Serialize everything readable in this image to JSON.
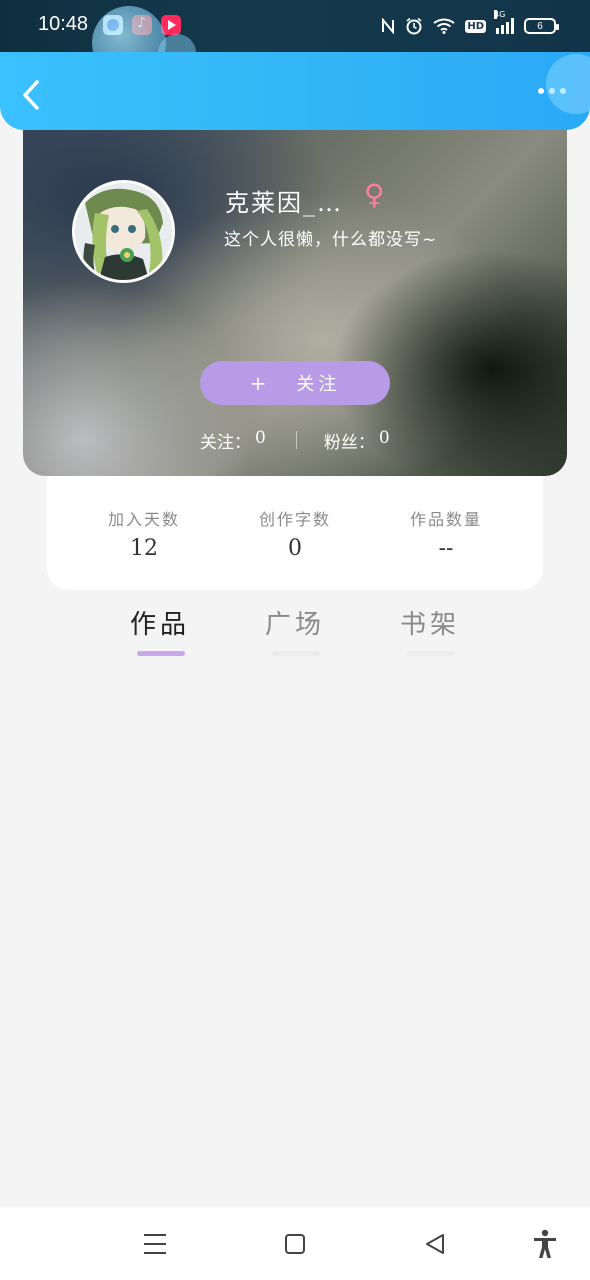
{
  "status_bar": {
    "time": "10:48",
    "network": "4G",
    "hd": "HD",
    "battery": "6"
  },
  "header": {
    "back_icon": "chevron-left-icon",
    "more_icon": "more-dots-icon"
  },
  "profile": {
    "username": "克莱因_…",
    "gender_symbol": "♀",
    "bio": "这个人很懒，什么都没写~",
    "follow_plus": "+",
    "follow_label": "关注",
    "following_label": "关注：",
    "following_value": "0",
    "fans_label": "粉丝：",
    "fans_value": "0"
  },
  "stats": [
    {
      "label": "加入天数",
      "value": "12"
    },
    {
      "label": "创作字数",
      "value": "0"
    },
    {
      "label": "作品数量",
      "value": "--"
    }
  ],
  "tabs": [
    {
      "label": "作品",
      "active": true
    },
    {
      "label": "广场",
      "active": false
    },
    {
      "label": "书架",
      "active": false
    }
  ],
  "colors": {
    "header_blue": "#33b6f5",
    "follow_button": "#b79be6",
    "active_tab_underline": "#c8a8e8",
    "gender_pink": "#ff7e9e"
  }
}
